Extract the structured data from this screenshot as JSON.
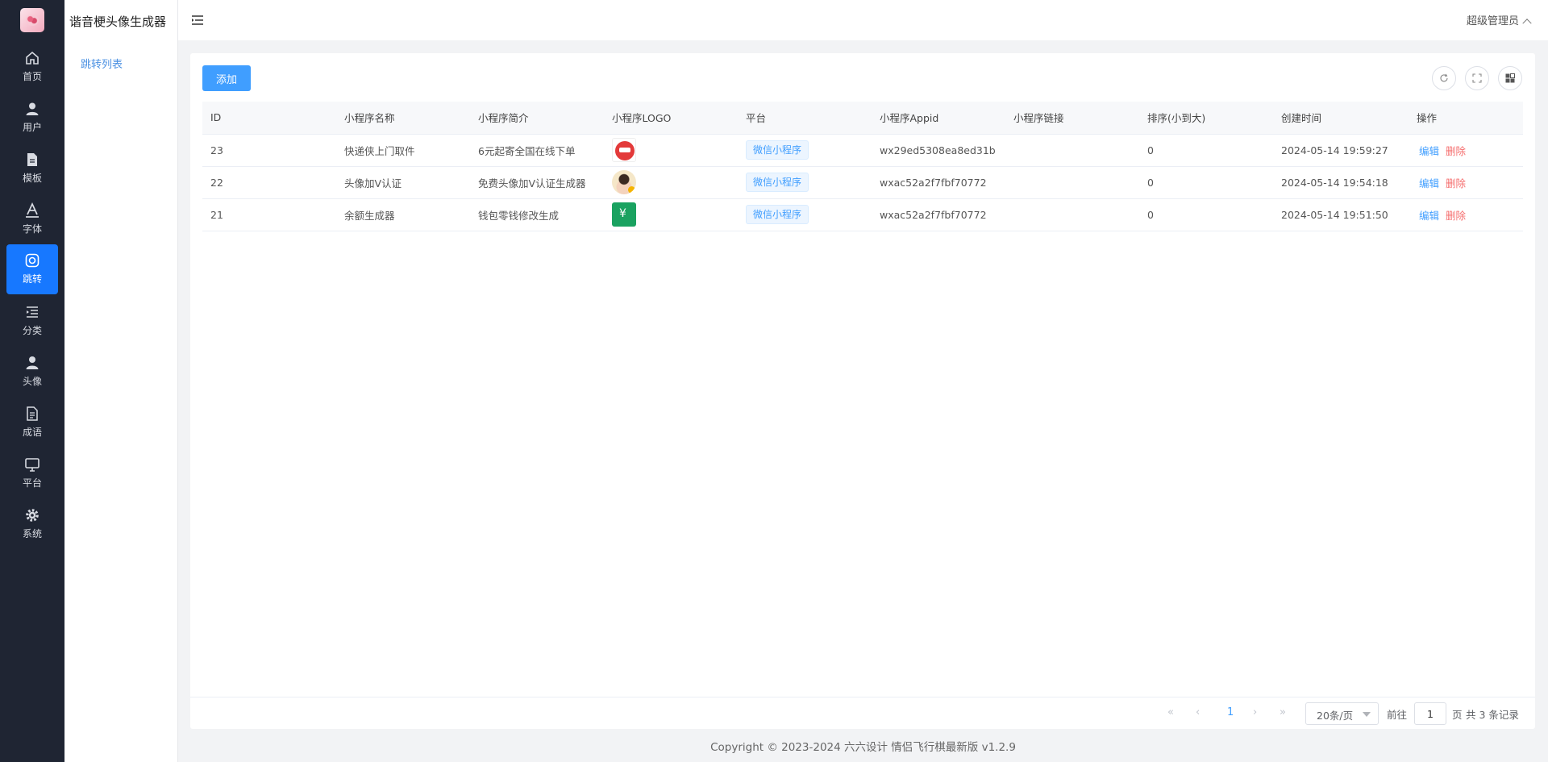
{
  "app": {
    "title": "谐音梗头像生成器"
  },
  "nav": [
    {
      "label": "首页",
      "icon": "home-icon"
    },
    {
      "label": "用户",
      "icon": "user-icon"
    },
    {
      "label": "模板",
      "icon": "document-icon"
    },
    {
      "label": "字体",
      "icon": "font-icon"
    },
    {
      "label": "跳转",
      "icon": "jump-icon",
      "active": true
    },
    {
      "label": "分类",
      "icon": "category-icon"
    },
    {
      "label": "头像",
      "icon": "avatar-icon"
    },
    {
      "label": "成语",
      "icon": "idiom-icon"
    },
    {
      "label": "平台",
      "icon": "monitor-icon"
    },
    {
      "label": "系统",
      "icon": "gear-icon"
    }
  ],
  "submenu": {
    "item": "跳转列表"
  },
  "header": {
    "user": "超级管理员"
  },
  "toolbar": {
    "add_label": "添加"
  },
  "table": {
    "columns": [
      "ID",
      "小程序名称",
      "小程序简介",
      "小程序LOGO",
      "平台",
      "小程序Appid",
      "小程序链接",
      "排序(小到大)",
      "创建时间",
      "操作"
    ],
    "rows": [
      {
        "id": "23",
        "name": "快递侠上门取件",
        "intro": "6元起寄全国在线下单",
        "logo": "logo-a",
        "platform": "微信小程序",
        "appid": "wx29ed5308ea8ed31b",
        "link": "",
        "sort": "0",
        "created": "2024-05-14 19:59:27"
      },
      {
        "id": "22",
        "name": "头像加V认证",
        "intro": "免费头像加V认证生成器",
        "logo": "logo-b",
        "platform": "微信小程序",
        "appid": "wxac52a2f7fbf70772",
        "link": "",
        "sort": "0",
        "created": "2024-05-14 19:54:18"
      },
      {
        "id": "21",
        "name": "余额生成器",
        "intro": "钱包零钱修改生成",
        "logo": "logo-c",
        "platform": "微信小程序",
        "appid": "wxac52a2f7fbf70772",
        "link": "",
        "sort": "0",
        "created": "2024-05-14 19:51:50"
      }
    ],
    "op_edit": "编辑",
    "op_delete": "删除"
  },
  "pagination": {
    "current": "1",
    "page_size": "20条/页",
    "goto_prefix": "前往",
    "goto_value": "1",
    "goto_suffix": "页",
    "total": "共 3 条记录"
  },
  "footer": {
    "copyright": "Copyright © 2023-2024 六六设计   情侣飞行棋最新版 v1.2.9"
  }
}
